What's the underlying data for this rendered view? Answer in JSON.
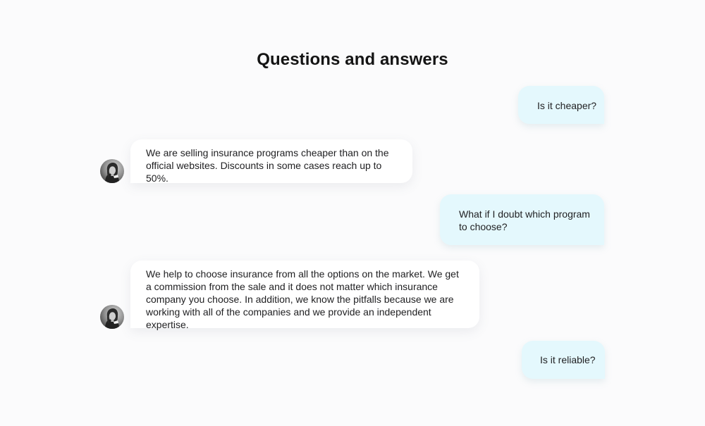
{
  "page": {
    "title": "Questions and answers"
  },
  "conversation": {
    "messages": [
      {
        "role": "user",
        "text": "Is it cheaper?"
      },
      {
        "role": "agent",
        "text": "We are selling insurance programs cheaper than on the official websites. Discounts in some cases reach up to 50%."
      },
      {
        "role": "user",
        "text": "What if I doubt which program to choose?"
      },
      {
        "role": "agent",
        "text": "We help to choose insurance from all the options on the market. We get a commission from the sale and it does not matter which insurance company you choose. In addition, we know the pitfalls because we are working with all of the companies and we provide an independent expertise."
      },
      {
        "role": "user",
        "text": "Is it reliable?"
      }
    ]
  },
  "colors": {
    "page_background": "#fbfbfc",
    "user_bubble": "#e4f8fd",
    "agent_bubble": "#ffffff"
  },
  "icons": {
    "agent_avatar": "agent-avatar-icon"
  }
}
